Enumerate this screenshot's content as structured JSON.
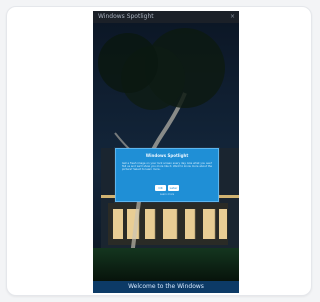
{
  "app": {
    "topbar_title": "Windows Spotlight",
    "close_glyph": "×"
  },
  "modal": {
    "title": "Windows Spotlight",
    "body": "Get a fresh image on your lock screen every day. Like what you see? Tell us and we'll show you more like it. Want to know more about the picture? Select to learn more.",
    "button_primary": "OK",
    "button_secondary": "Later",
    "footer": "Learn more"
  },
  "bottom_bar": {
    "text": "Welcome to the Windows"
  },
  "colors": {
    "modal_bg": "#1f8fd6",
    "bottom_bar_bg": "#0c3a66",
    "topbar_bg": "#1b2028"
  }
}
